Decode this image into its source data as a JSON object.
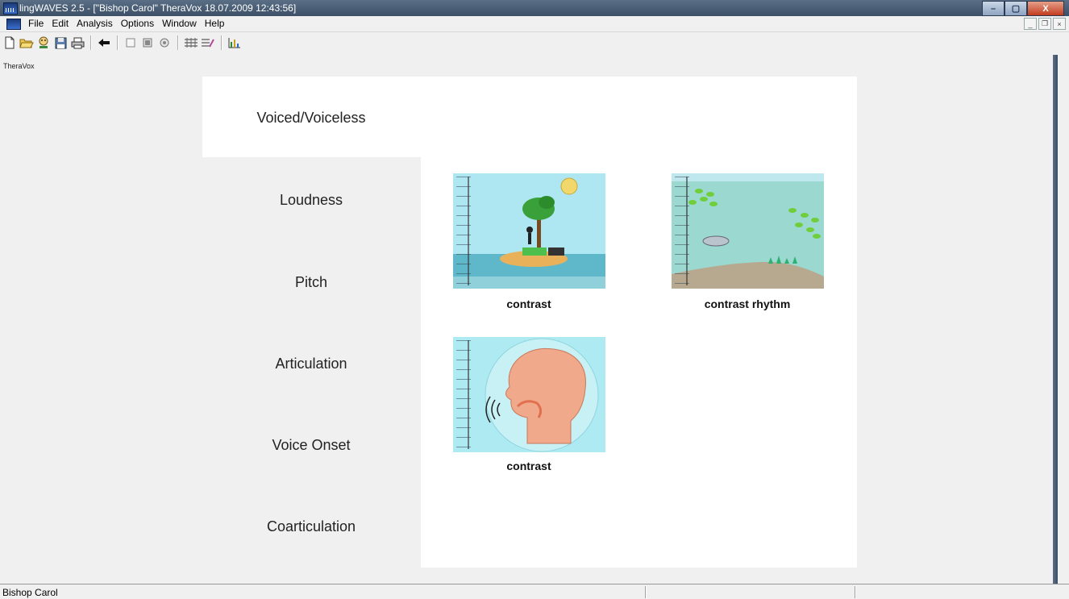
{
  "window": {
    "title": "lingWAVES 2.5 - [\"Bishop Carol\" TheraVox  18.07.2009 12:43:56]",
    "controls": {
      "minimize": "–",
      "maximize": "▢",
      "close": "X"
    }
  },
  "menubar": {
    "items": [
      "File",
      "Edit",
      "Analysis",
      "Options",
      "Window",
      "Help"
    ],
    "mdi_controls": {
      "minimize": "_",
      "restore": "❐",
      "close": "×"
    }
  },
  "toolbar": {
    "icons": [
      "new-icon",
      "open-icon",
      "patient-icon",
      "save-icon",
      "print-icon",
      "back-arrow-icon",
      "stop-square-icon",
      "record-square-icon",
      "record-circle-icon",
      "waveform-grid-icon",
      "edit-waveform-icon",
      "bar-chart-icon"
    ]
  },
  "document": {
    "label": "TheraVox"
  },
  "categories": [
    {
      "label": "Voiced/Voiceless",
      "selected": true
    },
    {
      "label": "Loudness"
    },
    {
      "label": "Pitch"
    },
    {
      "label": "Articulation"
    },
    {
      "label": "Voice Onset"
    },
    {
      "label": "Coarticulation"
    }
  ],
  "exercises": [
    {
      "label": "contrast",
      "icon": "island-scene-icon",
      "colors": {
        "sky": "#aee6f2",
        "sea": "#5fb8c9"
      }
    },
    {
      "label": "contrast rhythm",
      "icon": "underwater-dolphin-icon",
      "colors": {
        "water": "#9ad8d0",
        "floor": "#b7a98f"
      }
    },
    {
      "label": "contrast",
      "icon": "head-profile-icon",
      "colors": {
        "bg": "#aeeaf2",
        "skin": "#f0a98a"
      }
    }
  ],
  "statusbar": {
    "user": "Bishop Carol"
  }
}
